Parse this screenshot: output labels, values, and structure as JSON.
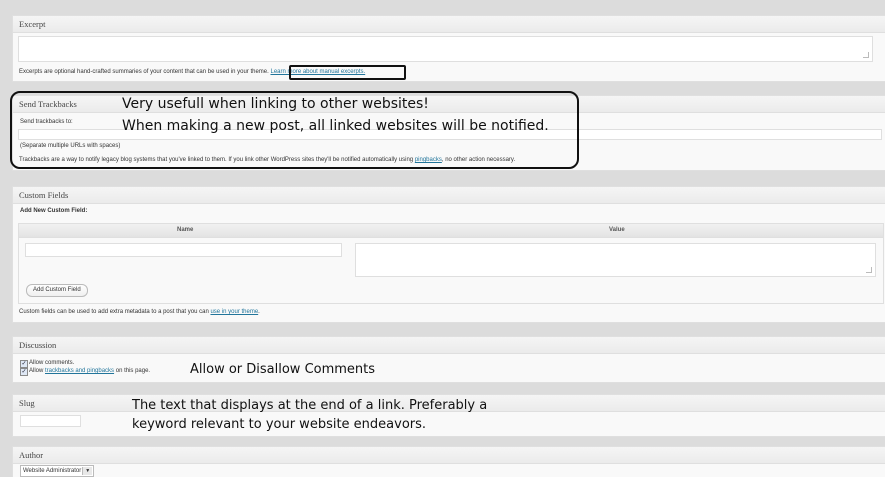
{
  "excerpt": {
    "title": "Excerpt",
    "help_text": "Excerpts are optional hand-crafted summaries of your content that can be used in your theme.",
    "help_link": "Learn more about manual excerpts."
  },
  "trackbacks": {
    "title": "Send Trackbacks",
    "label": "Send trackbacks to:",
    "separate_note": "(Separate multiple URLs with spaces)",
    "desc_before": "Trackbacks are a way to notify legacy blog systems that you've linked to them. If you link other WordPress sites they'll be notified automatically using",
    "desc_link": "pingbacks",
    "desc_after": ", no other action necessary.",
    "annotation_line1": "Very usefull when linking to other websites!",
    "annotation_line2": "When making a new post, all linked websites will be notified."
  },
  "custom_fields": {
    "title": "Custom Fields",
    "add_new_label": "Add New Custom Field:",
    "col_name": "Name",
    "col_value": "Value",
    "add_button": "Add Custom Field",
    "help_before": "Custom fields can be used to add extra metadata to a post that you can",
    "help_link": "use in your theme",
    "help_after": "."
  },
  "discussion": {
    "title": "Discussion",
    "allow_comments": "Allow comments.",
    "allow_prefix": "Allow",
    "allow_link": "trackbacks and pingbacks",
    "allow_suffix": "on this page.",
    "annotation": "Allow or Disallow Comments"
  },
  "slug": {
    "title": "Slug",
    "annotation_line1": "The text that displays at the end of a link. Preferably a",
    "annotation_line2": "keyword relevant to your website endeavors."
  },
  "author": {
    "title": "Author",
    "selected": "Website Administrator"
  },
  "colors": {
    "link": "#21759b",
    "panel_bg": "#f9f9f9",
    "page_bg": "#dcdcdc",
    "annotation_border": "#111111"
  }
}
